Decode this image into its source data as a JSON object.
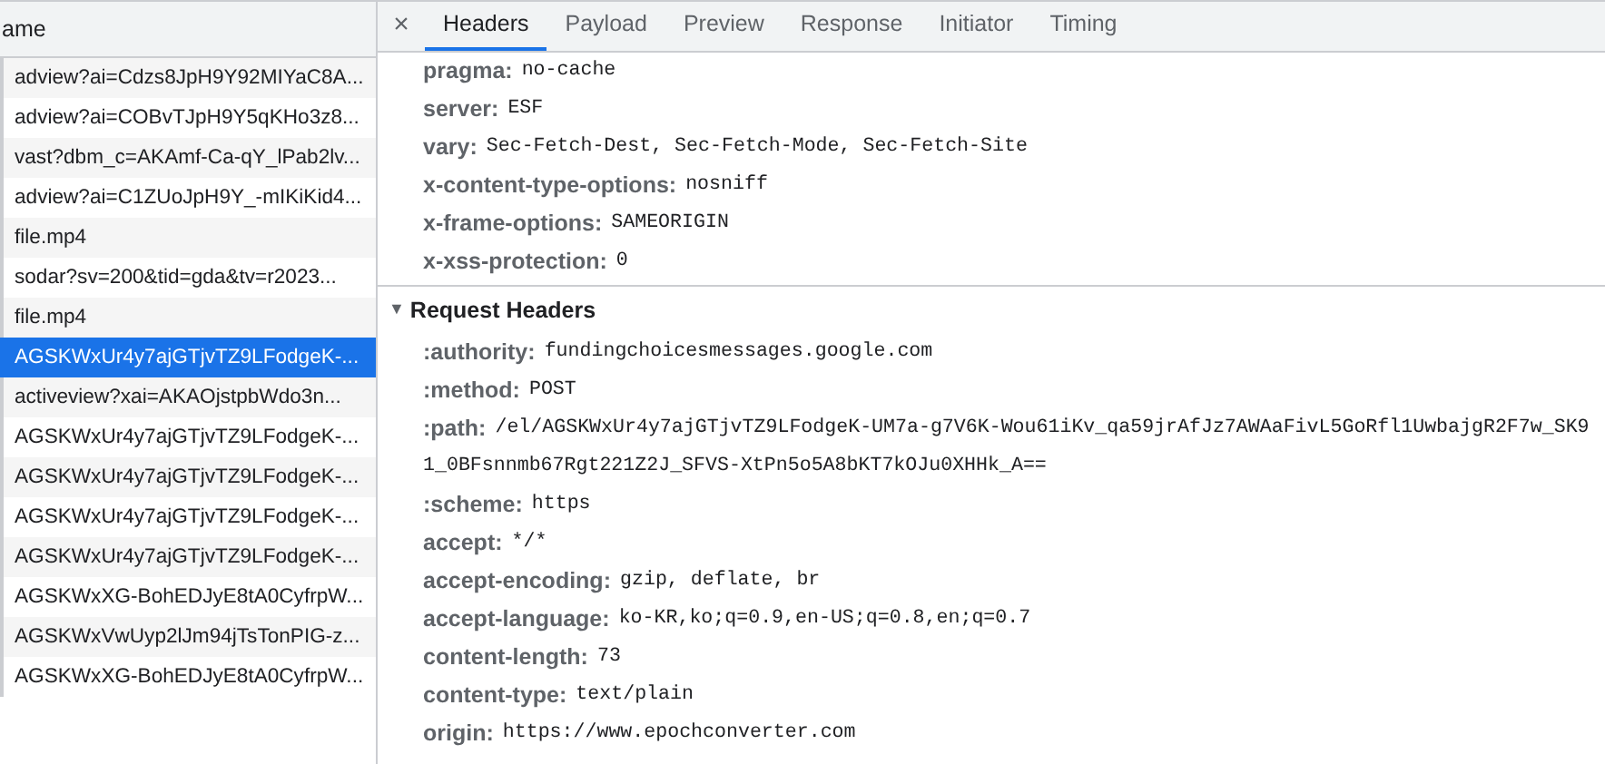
{
  "requests": {
    "column_heading": "ame",
    "rows": [
      {
        "name": "adview?ai=Cdzs8JpH9Y92MIYaC8A...",
        "selected": false
      },
      {
        "name": "adview?ai=COBvTJpH9Y5qKHo3z8...",
        "selected": false
      },
      {
        "name": "vast?dbm_c=AKAmf-Ca-qY_lPab2lv...",
        "selected": false
      },
      {
        "name": "adview?ai=C1ZUoJpH9Y_-mIKiKid4...",
        "selected": false
      },
      {
        "name": "file.mp4",
        "selected": false
      },
      {
        "name": "sodar?sv=200&tid=gda&tv=r2023...",
        "selected": false
      },
      {
        "name": "file.mp4",
        "selected": false
      },
      {
        "name": "AGSKWxUr4y7ajGTjvTZ9LFodgeK-...",
        "selected": true
      },
      {
        "name": "activeview?xai=AKAOjstpbWdo3n...",
        "selected": false
      },
      {
        "name": "AGSKWxUr4y7ajGTjvTZ9LFodgeK-...",
        "selected": false
      },
      {
        "name": "AGSKWxUr4y7ajGTjvTZ9LFodgeK-...",
        "selected": false
      },
      {
        "name": "AGSKWxUr4y7ajGTjvTZ9LFodgeK-...",
        "selected": false
      },
      {
        "name": "AGSKWxUr4y7ajGTjvTZ9LFodgeK-...",
        "selected": false
      },
      {
        "name": "AGSKWxXG-BohEDJyE8tA0CyfrpW...",
        "selected": false
      },
      {
        "name": "AGSKWxVwUyp2lJm94jTsTonPIG-z...",
        "selected": false
      },
      {
        "name": "AGSKWxXG-BohEDJyE8tA0CyfrpW...",
        "selected": false
      }
    ]
  },
  "details": {
    "close": "×",
    "tabs": [
      {
        "label": "Headers",
        "selected": true
      },
      {
        "label": "Payload",
        "selected": false
      },
      {
        "label": "Preview",
        "selected": false
      },
      {
        "label": "Response",
        "selected": false
      },
      {
        "label": "Initiator",
        "selected": false
      },
      {
        "label": "Timing",
        "selected": false
      }
    ],
    "response_headers": [
      {
        "key": "pragma:",
        "value": [
          "no-cache"
        ]
      },
      {
        "key": "server:",
        "value": [
          "ESF"
        ]
      },
      {
        "key": "vary:",
        "value": [
          "Sec-Fetch-Dest, Sec-Fetch-Mode, Sec-Fetch-Site"
        ]
      },
      {
        "key": "x-content-type-options:",
        "value": [
          "nosniff"
        ]
      },
      {
        "key": "x-frame-options:",
        "value": [
          "SAMEORIGIN"
        ]
      },
      {
        "key": "x-xss-protection:",
        "value": [
          "0"
        ]
      }
    ],
    "request_section": {
      "toggle": "▼",
      "title": "Request Headers",
      "expanded": true
    },
    "request_headers": [
      {
        "key": ":authority:",
        "value": [
          "fundingchoicesmessages.google.com"
        ]
      },
      {
        "key": ":method:",
        "value": [
          "POST"
        ]
      },
      {
        "key": ":path:",
        "value": [
          "/el/AGSKWxUr4y7ajGTjvTZ9LFodgeK-UM7a-g7V6K-Wou61iKv_qa59jrAfJz7AWAaFivL5GoRfl1UwbajgR2F7w_SK9",
          "1_0BFsnnmb67Rgt221Z2J_SFVS-XtPn5o5A8bKT7kOJu0XHHk_A=="
        ]
      },
      {
        "key": ":scheme:",
        "value": [
          "https"
        ]
      },
      {
        "key": "accept:",
        "value": [
          "*/*"
        ]
      },
      {
        "key": "accept-encoding:",
        "value": [
          "gzip, deflate, br"
        ]
      },
      {
        "key": "accept-language:",
        "value": [
          "ko-KR,ko;q=0.9,en-US;q=0.8,en;q=0.7"
        ]
      },
      {
        "key": "content-length:",
        "value": [
          "73"
        ]
      },
      {
        "key": "content-type:",
        "value": [
          "text/plain"
        ]
      },
      {
        "key": "origin:",
        "value": [
          "https://www.epochconverter.com"
        ]
      }
    ]
  }
}
